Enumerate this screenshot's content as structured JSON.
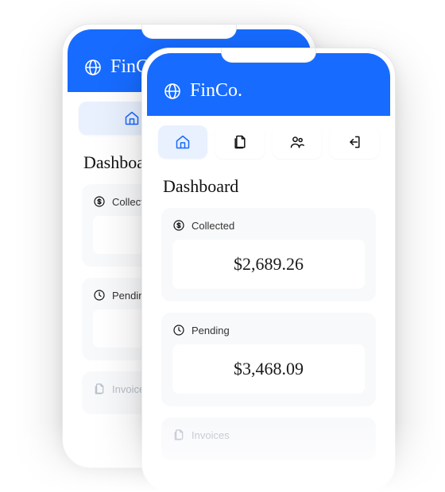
{
  "brand": {
    "name": "FinCo."
  },
  "nav": {
    "home": "home-icon",
    "documents": "documents-icon",
    "users": "users-icon",
    "logout": "logout-icon",
    "active": "home"
  },
  "page": {
    "title": "Dashboard"
  },
  "cards": {
    "collected": {
      "label": "Collected",
      "value": "$2,689.26"
    },
    "pending": {
      "label": "Pending",
      "value": "$3,468.09"
    },
    "invoices": {
      "label": "Invoices"
    }
  }
}
